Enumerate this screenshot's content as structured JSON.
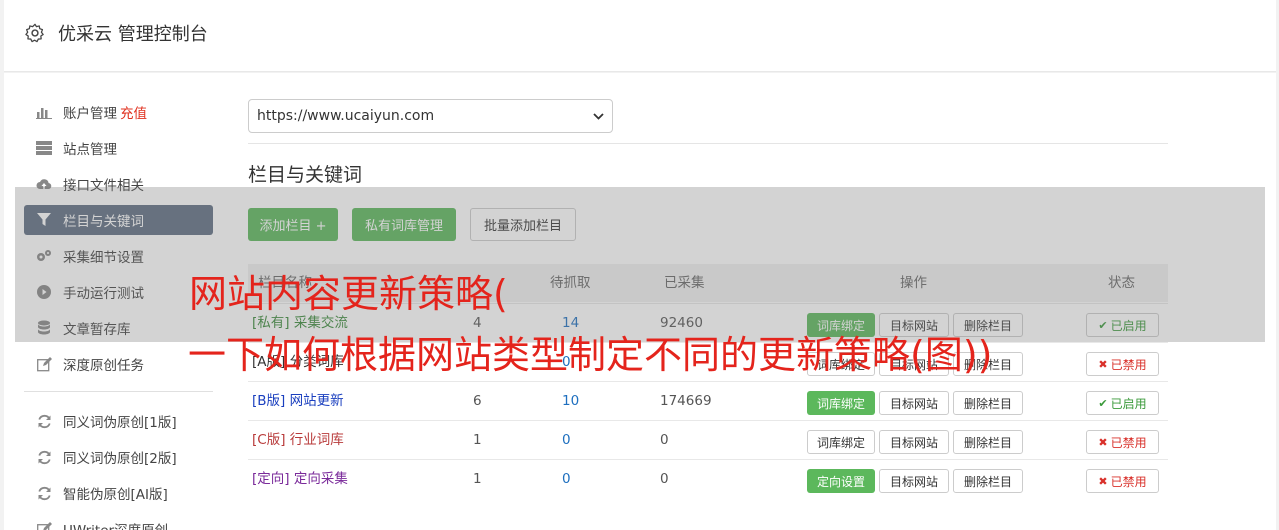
{
  "app": {
    "title": "优采云 管理控制台",
    "icon": "gear-icon"
  },
  "sidebar": {
    "items": [
      {
        "label": "账户管理",
        "extra": "充值",
        "icon": "bar-chart-icon"
      },
      {
        "label": "站点管理",
        "icon": "server-icon"
      },
      {
        "label": "接口文件相关",
        "icon": "cloud-upload-icon"
      },
      {
        "label": "栏目与关键词",
        "icon": "filter-icon",
        "active": true
      },
      {
        "label": "采集细节设置",
        "icon": "cogs-icon"
      },
      {
        "label": "手动运行测试",
        "icon": "play-icon"
      },
      {
        "label": "文章暂存库",
        "icon": "database-icon"
      },
      {
        "label": "深度原创任务",
        "icon": "edit-icon"
      },
      {
        "label": "同义词伪原创[1版]",
        "icon": "refresh-icon"
      },
      {
        "label": "同义词伪原创[2版]",
        "icon": "refresh-icon"
      },
      {
        "label": "智能伪原创[AI版]",
        "icon": "refresh-icon"
      },
      {
        "label": "UWriter深度原创",
        "icon": "edit-icon"
      }
    ]
  },
  "site_select": {
    "value": "https://www.ucaiyun.com"
  },
  "section": {
    "title": "栏目与关键词"
  },
  "toolbar": {
    "add_column": "添加栏目 +",
    "private_lib": "私有词库管理",
    "batch_add": "批量添加栏目"
  },
  "table": {
    "headers": {
      "name": "栏目名称",
      "pending": "待抓取",
      "collected": "已采集",
      "actions": "操作",
      "status": "状态"
    },
    "rows": [
      {
        "tag": "[私有]",
        "name": "采集交流",
        "keywords": "4",
        "pending": "14",
        "collected": "92460",
        "btn1": "词库绑定",
        "btn2": "目标网站",
        "btn3": "删除栏目",
        "status": "已启用",
        "color": "#3a8a3a"
      },
      {
        "tag": "[A版]",
        "name": "分类词库",
        "keywords": "",
        "pending": "0",
        "collected": "",
        "btn1": "词库绑定",
        "btn2": "目标网站",
        "btn3": "删除栏目",
        "status": "已禁用",
        "color": "#333333"
      },
      {
        "tag": "[B版]",
        "name": "网站更新",
        "keywords": "6",
        "pending": "10",
        "collected": "174669",
        "btn1": "词库绑定",
        "btn2": "目标网站",
        "btn3": "删除栏目",
        "status": "已启用",
        "color": "#1a3fbf"
      },
      {
        "tag": "[C版]",
        "name": "行业词库",
        "keywords": "1",
        "pending": "0",
        "collected": "0",
        "btn1": "词库绑定",
        "btn2": "目标网站",
        "btn3": "删除栏目",
        "status": "已禁用",
        "color": "#b83a3a"
      },
      {
        "tag": "[定向]",
        "name": "定向采集",
        "keywords": "1",
        "pending": "0",
        "collected": "0",
        "btn1": "定向设置",
        "btn2": "目标网站",
        "btn3": "删除栏目",
        "status": "已禁用",
        "color": "#7a2a9a"
      }
    ]
  },
  "overlay": {
    "line1": "网站内容更新策略(",
    "line2": "一下如何根据网站类型制定不同的更新策略(图))"
  },
  "colors": {
    "accent_green": "#5cb85c",
    "sidebar_active": "#5f6e82",
    "overlay_red": "#e4241c",
    "recharge_red": "#e0301e"
  }
}
